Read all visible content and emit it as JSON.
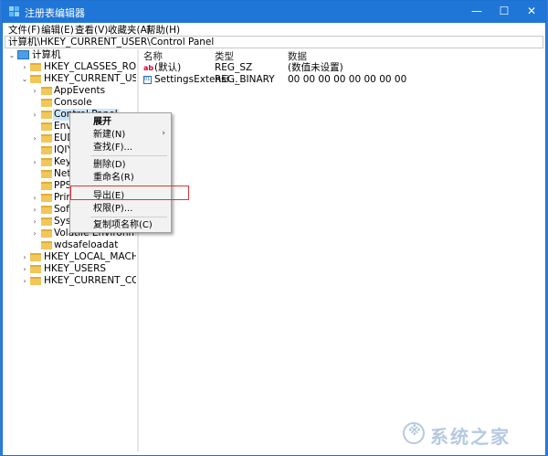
{
  "window": {
    "title": "注册表编辑器",
    "controls": {
      "minimize": "—",
      "maximize": "☐",
      "close": "✕"
    }
  },
  "menubar": [
    "文件(F)",
    "编辑(E)",
    "查看(V)",
    "收藏夹(A)",
    "帮助(H)"
  ],
  "address": "计算机\\HKEY_CURRENT_USER\\Control Panel",
  "tree": {
    "root": "计算机",
    "hives": [
      "HKEY_CLASSES_ROOT",
      "HKEY_CURRENT_USER",
      "HKEY_LOCAL_MACHINE",
      "HKEY_USERS",
      "HKEY_CURRENT_CONFIG"
    ],
    "hkcu_children": [
      "AppEvents",
      "Console",
      "Control Panel",
      "Enviro",
      "EUDC",
      "IQIYI.",
      "Keybo",
      "Netwo",
      "PPStr",
      "Printe",
      "Softw",
      "Syster",
      "Volatile Environment",
      "wdsafeloadat"
    ]
  },
  "list": {
    "headers": {
      "name": "名称",
      "type": "类型",
      "data": "数据"
    },
    "rows": [
      {
        "icon": "ab",
        "name": "(默认)",
        "type": "REG_SZ",
        "data": "(数值未设置)"
      },
      {
        "icon": "bin",
        "name": "SettingsExtensi...",
        "type": "REG_BINARY",
        "data": "00 00 00 00 00 00 00 00"
      }
    ]
  },
  "context_menu": {
    "items": [
      "展开",
      "新建(N)",
      "查找(F)...",
      "删除(D)",
      "重命名(R)",
      "导出(E)",
      "权限(P)...",
      "复制项名称(C)"
    ],
    "submenu_arrow": "›",
    "highlighted_item": "导出(E)"
  },
  "watermark": {
    "icon_glyph": "※",
    "text": "系统之家"
  },
  "colors": {
    "titlebar": "#1f76d6",
    "highlight_border": "#e23434",
    "selection": "#cce4f7"
  }
}
